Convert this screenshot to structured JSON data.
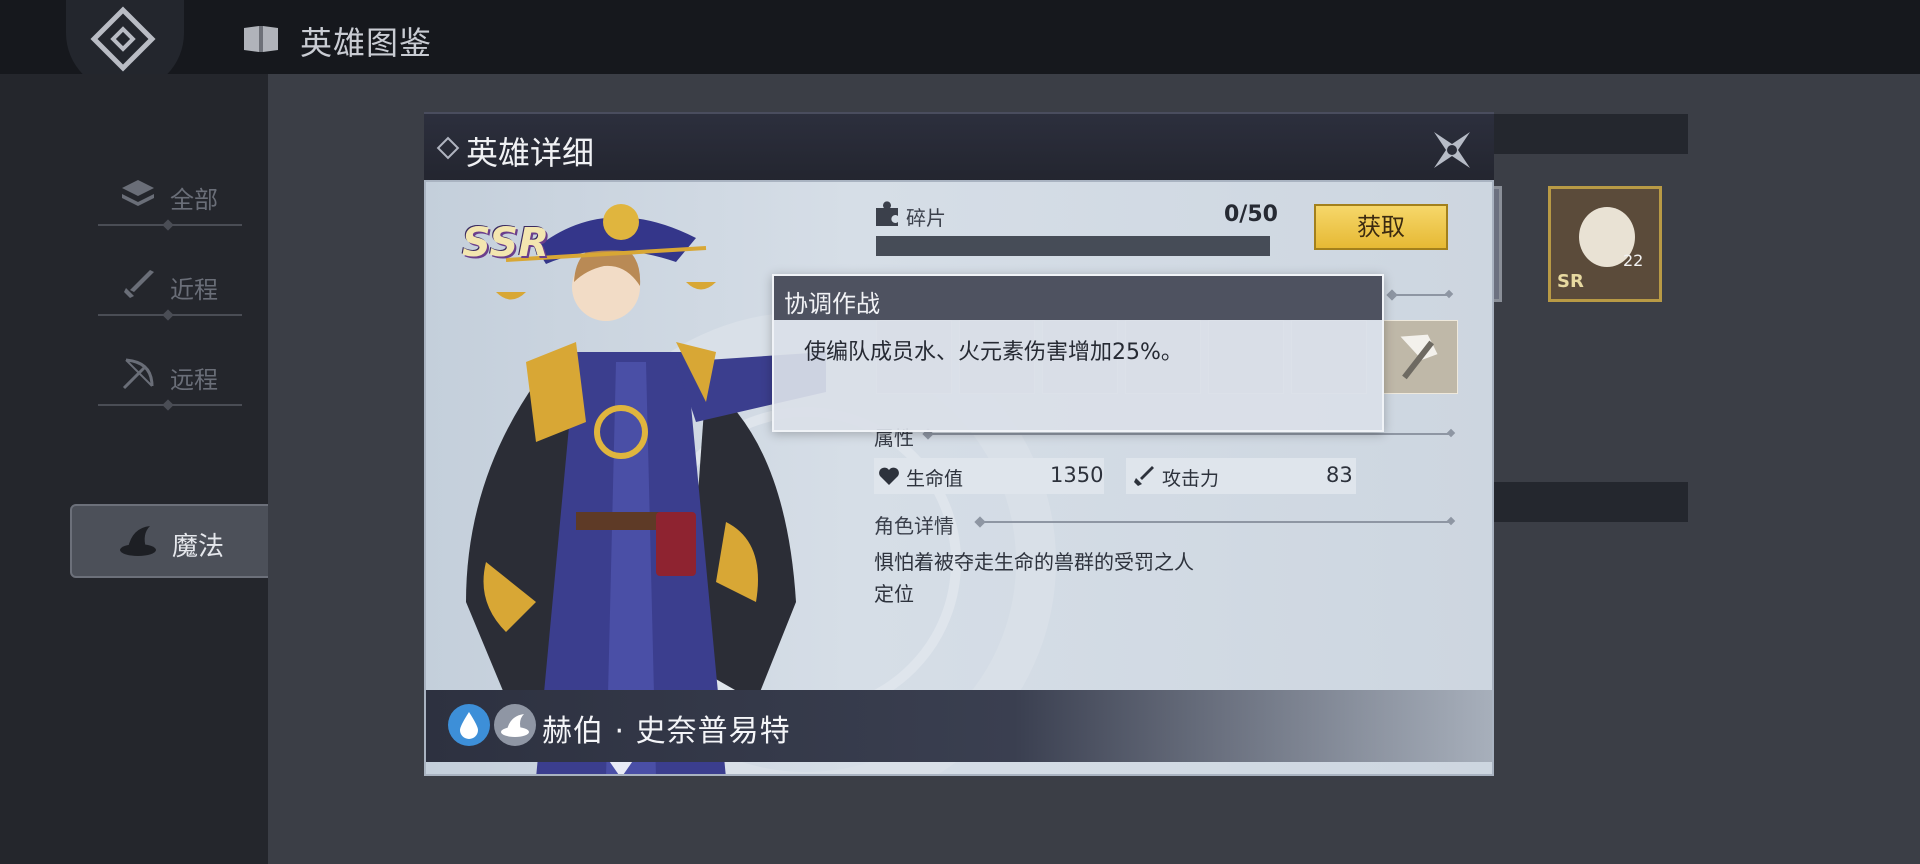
{
  "topbar": {
    "title": "英雄图鉴"
  },
  "sidebar": {
    "items": [
      {
        "label": "全部"
      },
      {
        "label": "近程"
      },
      {
        "label": "远程"
      },
      {
        "label": "魔法"
      }
    ]
  },
  "dialog": {
    "title": "英雄详细",
    "rarity": "SSR",
    "fragments": {
      "label": "碎片",
      "count": "0/50",
      "progress": 0.0
    },
    "get_button": "获取",
    "attributes": {
      "label": "属性",
      "hp_label": "生命值",
      "hp_value": "1350",
      "atk_label": "攻击力",
      "atk_value": "83"
    },
    "details": {
      "label": "角色详情",
      "line1": "惧怕着被夺走生命的兽群的受罚之人",
      "line2": "定位"
    },
    "hero_name": "赫伯 · 史奈普易特",
    "tooltip": {
      "title": "协调作战",
      "text": "使编队成员水、火元素伤害增加25%。"
    }
  },
  "background_cards": [
    {
      "rarity": "SR",
      "level": "22"
    }
  ]
}
